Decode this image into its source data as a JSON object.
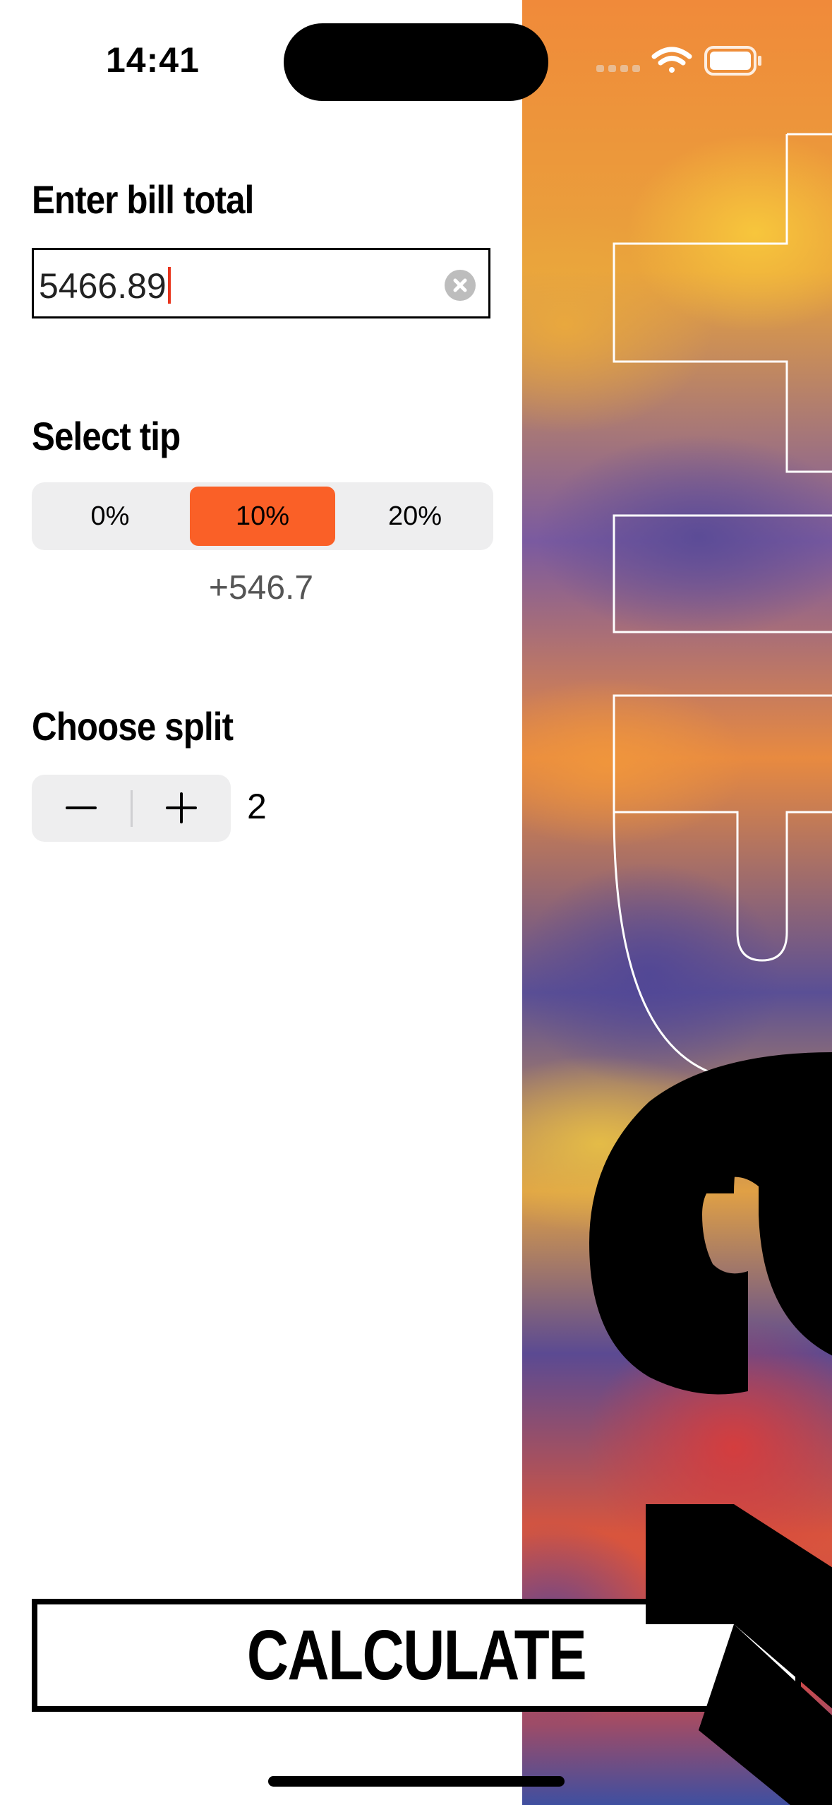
{
  "status_bar": {
    "time": "14:41"
  },
  "bill": {
    "label": "Enter bill total",
    "value": "5466.89"
  },
  "tip": {
    "label": "Select tip",
    "options": [
      "0%",
      "10%",
      "20%"
    ],
    "selected": "10%",
    "amount": "+546.7"
  },
  "split": {
    "label": "Choose split",
    "count": "2"
  },
  "calculate": {
    "label": "CALCULATE"
  },
  "decoration": {
    "vertical_text": "tips",
    "accent_text": "YS"
  },
  "colors": {
    "accent": "#fa6027",
    "caret": "#e8341c"
  }
}
